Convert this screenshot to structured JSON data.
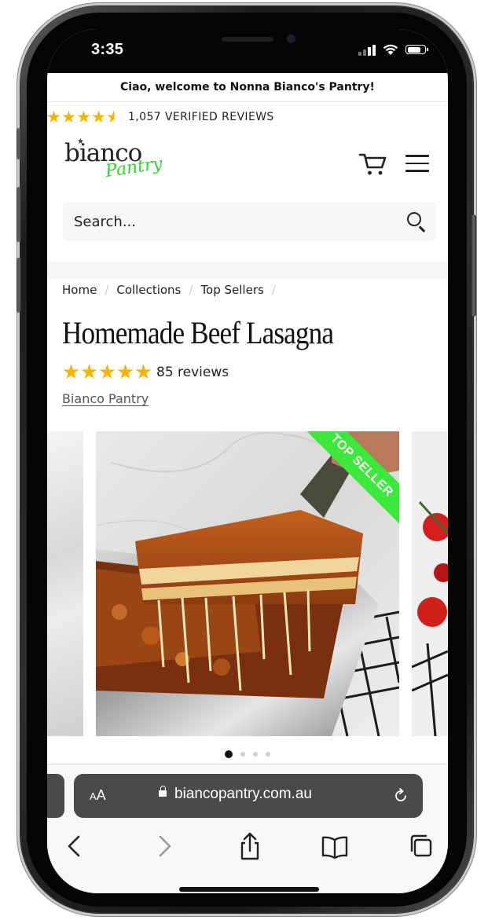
{
  "status": {
    "time": "3:35"
  },
  "announcement": {
    "text": "Ciao, welcome to Nonna Bianco's Pantry!"
  },
  "store_reviews": {
    "rating": 4.5,
    "max": 5,
    "label": "1,057 VERIFIED REVIEWS"
  },
  "header": {
    "logo_main": "bianco",
    "logo_script": "Pantry",
    "icons": [
      "cart-icon",
      "menu-icon"
    ]
  },
  "search": {
    "placeholder": "Search..."
  },
  "breadcrumb": {
    "items": [
      "Home",
      "Collections",
      "Top Sellers"
    ],
    "separator": "/"
  },
  "product": {
    "title": "Homemade Beef Lasagna",
    "rating": 5,
    "reviews_label": "85 reviews",
    "vendor": "Bianco Pantry",
    "badge": "TOP SELLER"
  },
  "gallery": {
    "slide_count": 4,
    "active_index": 0
  },
  "browser": {
    "aa_label": "AA",
    "url": "biancopantry.com.au",
    "toolbar_icons": [
      "back-icon",
      "forward-icon",
      "share-icon",
      "bookmarks-icon",
      "tabs-icon"
    ]
  },
  "colors": {
    "star": "#f4b400",
    "brand_green": "#3ce83c",
    "url_bar": "#4a4a4a"
  }
}
